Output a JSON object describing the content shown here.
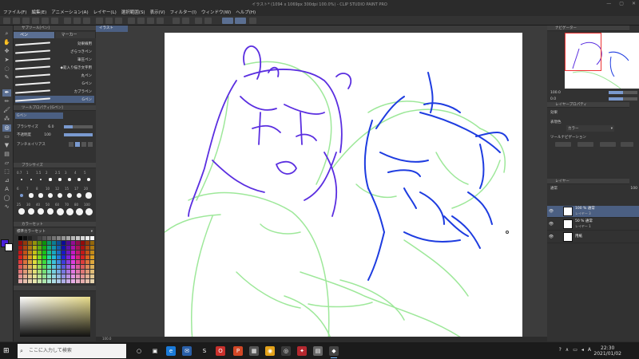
{
  "window": {
    "title": "イラスト* (1094 x 1069px 300dpi 100.0%) - CLIP STUDIO PAINT PRO",
    "min": "—",
    "max": "▢",
    "close": "✕"
  },
  "menu": [
    "ファイル(F)",
    "編集(E)",
    "アニメーション(A)",
    "レイヤー(L)",
    "選択範囲(S)",
    "表示(V)",
    "フィルター(I)",
    "ウィンドウ(W)",
    "ヘルプ(H)"
  ],
  "brush_panel": {
    "header": "サブツール[ペン]",
    "tabs": [
      "ペン",
      "マーカー"
    ],
    "items": [
      "効果線用",
      "ざらつきペン",
      "筆圧ペン",
      "◆鉛入り描き文字用",
      "丸ペン",
      "Gペン",
      "カブラペン",
      "Gペン"
    ]
  },
  "tool_property": {
    "header": "ツールプロパティ[Gペン]",
    "name": "Gペン",
    "brush_size_label": "ブラシサイズ",
    "brush_size": "6.0",
    "opacity_label": "不透明度",
    "opacity": "100",
    "antialias_label": "アンチエイリアス",
    "brush_size_fill": 0.3,
    "opacity_fill": 1.0
  },
  "brush_size_panel": {
    "header": "ブラシサイズ",
    "sizes": [
      "0.7",
      "1",
      "1.5",
      "2",
      "2.5",
      "3",
      "4",
      "5",
      "6",
      "7",
      "8",
      "10",
      "12",
      "15",
      "17",
      "20",
      "25",
      "30",
      "40",
      "50",
      "60",
      "70",
      "80",
      "100"
    ]
  },
  "color_set": {
    "header": "カラーセット",
    "set_name": "標準カラーセット"
  },
  "canvas": {
    "tab": "イラスト",
    "status": "100.0"
  },
  "navigator": {
    "header": "ナビゲーター",
    "zoom": "100.0",
    "rotate": "0.0"
  },
  "layer_property": {
    "header": "レイヤープロパティ",
    "effect_label": "効果",
    "expression_label": "表現色",
    "expression_value": "カラー",
    "tool_label": "ツールナビゲーション"
  },
  "layers": {
    "header": "レイヤー",
    "blend": "通常",
    "opacity": "100",
    "items": [
      {
        "name": "100 % 通常",
        "sub": "レイヤー 3",
        "active": true
      },
      {
        "name": "50 % 通常",
        "sub": "レイヤー 1",
        "active": false
      },
      {
        "name": "用紙",
        "sub": "",
        "active": false
      }
    ]
  },
  "taskbar": {
    "search_placeholder": "ここに入力して検索",
    "time": "22:30",
    "date": "2021/01/02",
    "ime": "A"
  }
}
